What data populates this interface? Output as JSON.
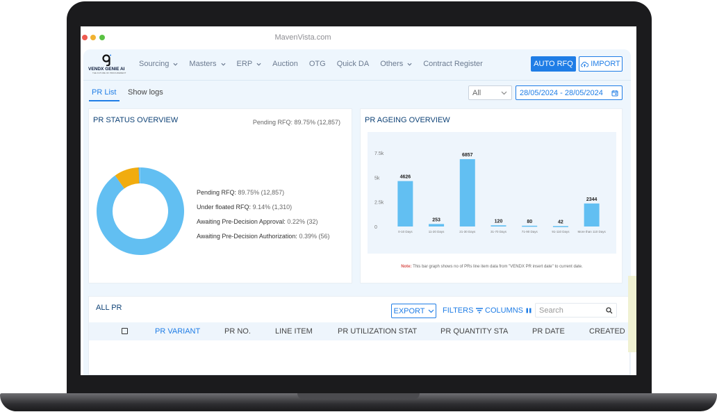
{
  "browser": {
    "url": "MavenVista.com"
  },
  "logo": {
    "name": "VENDX GENIE AI",
    "tagline": "THE FUTURE OF PROCUREMENT"
  },
  "nav": {
    "items": [
      {
        "label": "Sourcing",
        "dropdown": true
      },
      {
        "label": "Masters",
        "dropdown": true
      },
      {
        "label": "ERP",
        "dropdown": true
      },
      {
        "label": "Auction",
        "dropdown": false
      },
      {
        "label": "OTG",
        "dropdown": false
      },
      {
        "label": "Quick DA",
        "dropdown": false
      },
      {
        "label": "Others",
        "dropdown": true
      },
      {
        "label": "Contract Register",
        "dropdown": false
      }
    ],
    "auto_rfq": "AUTO RFQ",
    "import": "IMPORT"
  },
  "tabs": {
    "pr_list": "PR List",
    "show_logs": "Show logs"
  },
  "filters": {
    "select_value": "All",
    "date_range": "28/05/2024 - 28/05/2024"
  },
  "status_card": {
    "title": "PR STATUS OVERVIEW",
    "pending_note": "Pending RFQ: 89.75% (12,857)",
    "legend": [
      {
        "label": "Pending RFQ:",
        "value": "89.75% (12,857)",
        "percent": 89.75,
        "color": "#62bff2"
      },
      {
        "label": "Under floated RFQ:",
        "value": "9.14% (1,310)",
        "percent": 9.14,
        "color": "#f1ac0f"
      },
      {
        "label": "Awaiting Pre-Decision Approval:",
        "value": "0.22% (32)",
        "percent": 0.22,
        "color": "#2a8ee8"
      },
      {
        "label": "Awaiting Pre-Decision Authorization:",
        "value": "0.39% (56)",
        "percent": 0.39,
        "color": "#8ad0f7"
      }
    ]
  },
  "ageing_card": {
    "title": "PR AGEING OVERVIEW",
    "note_prefix": "Note:",
    "note_text": "This bar graph shows no of PRs line item data from \"VENDX PR insert date\" to current date."
  },
  "chart_data": {
    "type": "bar",
    "categories": [
      "0-10 Days",
      "11-20 Days",
      "21-30 Days",
      "31-70 Days",
      "71-90 Days",
      "91-110 Days",
      "More than 110 Days"
    ],
    "values": [
      4626,
      253,
      6857,
      120,
      80,
      42,
      2344
    ],
    "y_ticks": [
      "0",
      "2.5k",
      "5k",
      "7.5k"
    ],
    "ylim": [
      0,
      7500
    ],
    "color": "#62bff2"
  },
  "table": {
    "title": "ALL PR",
    "export": "EXPORT",
    "filters": "FILTERS",
    "columns": "COLUMNS",
    "search_placeholder": "Search",
    "headers": [
      "PR VARIANT",
      "PR NO.",
      "LINE ITEM",
      "PR UTILIZATION STAT",
      "PR QUANTITY STA",
      "PR DATE",
      "CREATED"
    ]
  }
}
